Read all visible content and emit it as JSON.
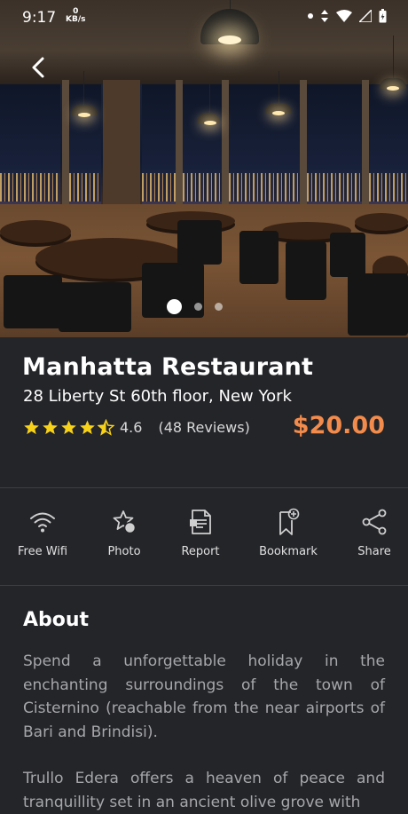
{
  "status_bar": {
    "time": "9:17",
    "net_speed_value": "0",
    "net_speed_unit": "KB/s"
  },
  "hero": {
    "carousel_count": 3,
    "active_index": 0
  },
  "restaurant": {
    "name": "Manhatta Restaurant",
    "address": "28 Liberty St 60th floor, New York",
    "rating": "4.6",
    "reviews": "(48 Reviews)",
    "price": "$20.00"
  },
  "actions": [
    {
      "label": "Free Wifi",
      "icon": "wifi-icon"
    },
    {
      "label": "Photo",
      "icon": "star-photo-icon"
    },
    {
      "label": "Report",
      "icon": "report-icon"
    },
    {
      "label": "Bookmark",
      "icon": "bookmark-icon"
    },
    {
      "label": "Share",
      "icon": "share-icon"
    }
  ],
  "about": {
    "heading": "About",
    "paragraph1": "Spend a unforgettable holiday in the enchanting surroundings of the town of Cisternino (reachable from the near airports of Bari and Brindisi).",
    "paragraph2": "Trullo Edera offers a heaven of peace and tranquillity set in an ancient olive grove with"
  },
  "colors": {
    "background": "#242529",
    "price": "#f28b4b",
    "star": "#f7d21a"
  }
}
